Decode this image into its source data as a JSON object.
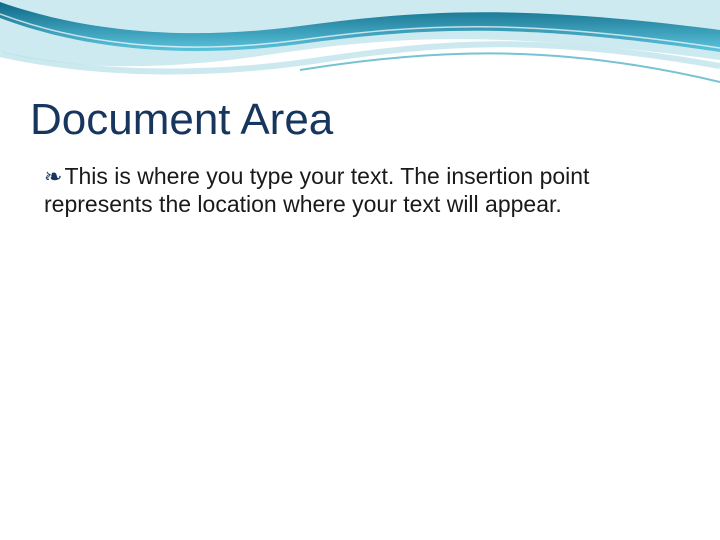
{
  "slide": {
    "title": "Document Area",
    "bullet_text": "This is where you type your text. The insertion point represents the location where your text will appear."
  },
  "theme": {
    "title_color": "#17365D",
    "wave_primary": "#1a9bb8",
    "wave_light": "#bfe3ec",
    "wave_gradient_top": "#0d6986",
    "wave_gradient_bottom": "#5ec5de"
  }
}
